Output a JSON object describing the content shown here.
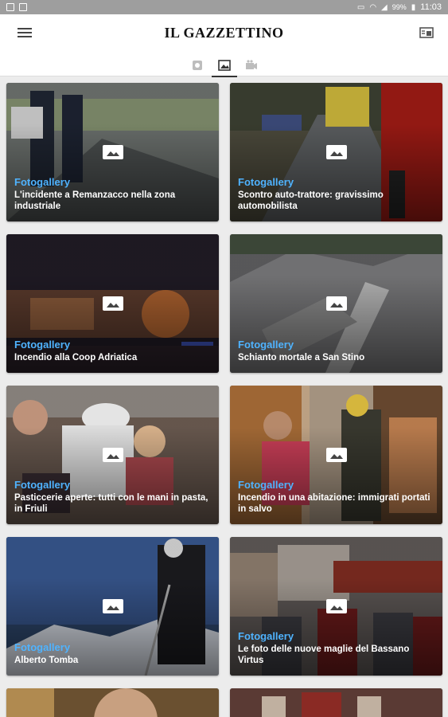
{
  "status_bar": {
    "battery": "99%",
    "time": "11:03"
  },
  "header": {
    "logo": "IL GAZZETTINO"
  },
  "tabs": [
    {
      "icon": "clock-icon",
      "active": false
    },
    {
      "icon": "image-icon",
      "active": true
    },
    {
      "icon": "video-icon",
      "active": false
    }
  ],
  "cards": [
    {
      "kicker": "Fotogallery",
      "title": "L'incidente a Remanzacco nella zona industriale",
      "bg": "#5b5f5e"
    },
    {
      "kicker": "Fotogallery",
      "title": "Scontro auto-trattore: gravissimo automobilista",
      "bg": "#4e4a3a"
    },
    {
      "kicker": "Fotogallery",
      "title": "Incendio alla Coop Adriatica",
      "bg": "#2a2430"
    },
    {
      "kicker": "Fotogallery",
      "title": "Schianto mortale a San Stino",
      "bg": "#5a5a5c"
    },
    {
      "kicker": "Fotogallery",
      "title": "Pasticcerie aperte: tutti con le mani in pasta, in Friuli",
      "bg": "#5c4a40"
    },
    {
      "kicker": "Fotogallery",
      "title": "Incendio in una abitazione: immigrati portati in salvo",
      "bg": "#6a4a2e"
    },
    {
      "kicker": "Fotogallery",
      "title": "Alberto Tomba",
      "bg": "#2f4666"
    },
    {
      "kicker": "Fotogallery",
      "title": "Le foto delle nuove maglie del Bassano Virtus",
      "bg": "#4a3a32"
    },
    {
      "kicker": "",
      "title": "",
      "bg": "#5a4430"
    },
    {
      "kicker": "",
      "title": "",
      "bg": "#4a3030"
    }
  ],
  "colors": {
    "accent": "#4fb3ff",
    "status_bar": "#9e9e9e"
  }
}
